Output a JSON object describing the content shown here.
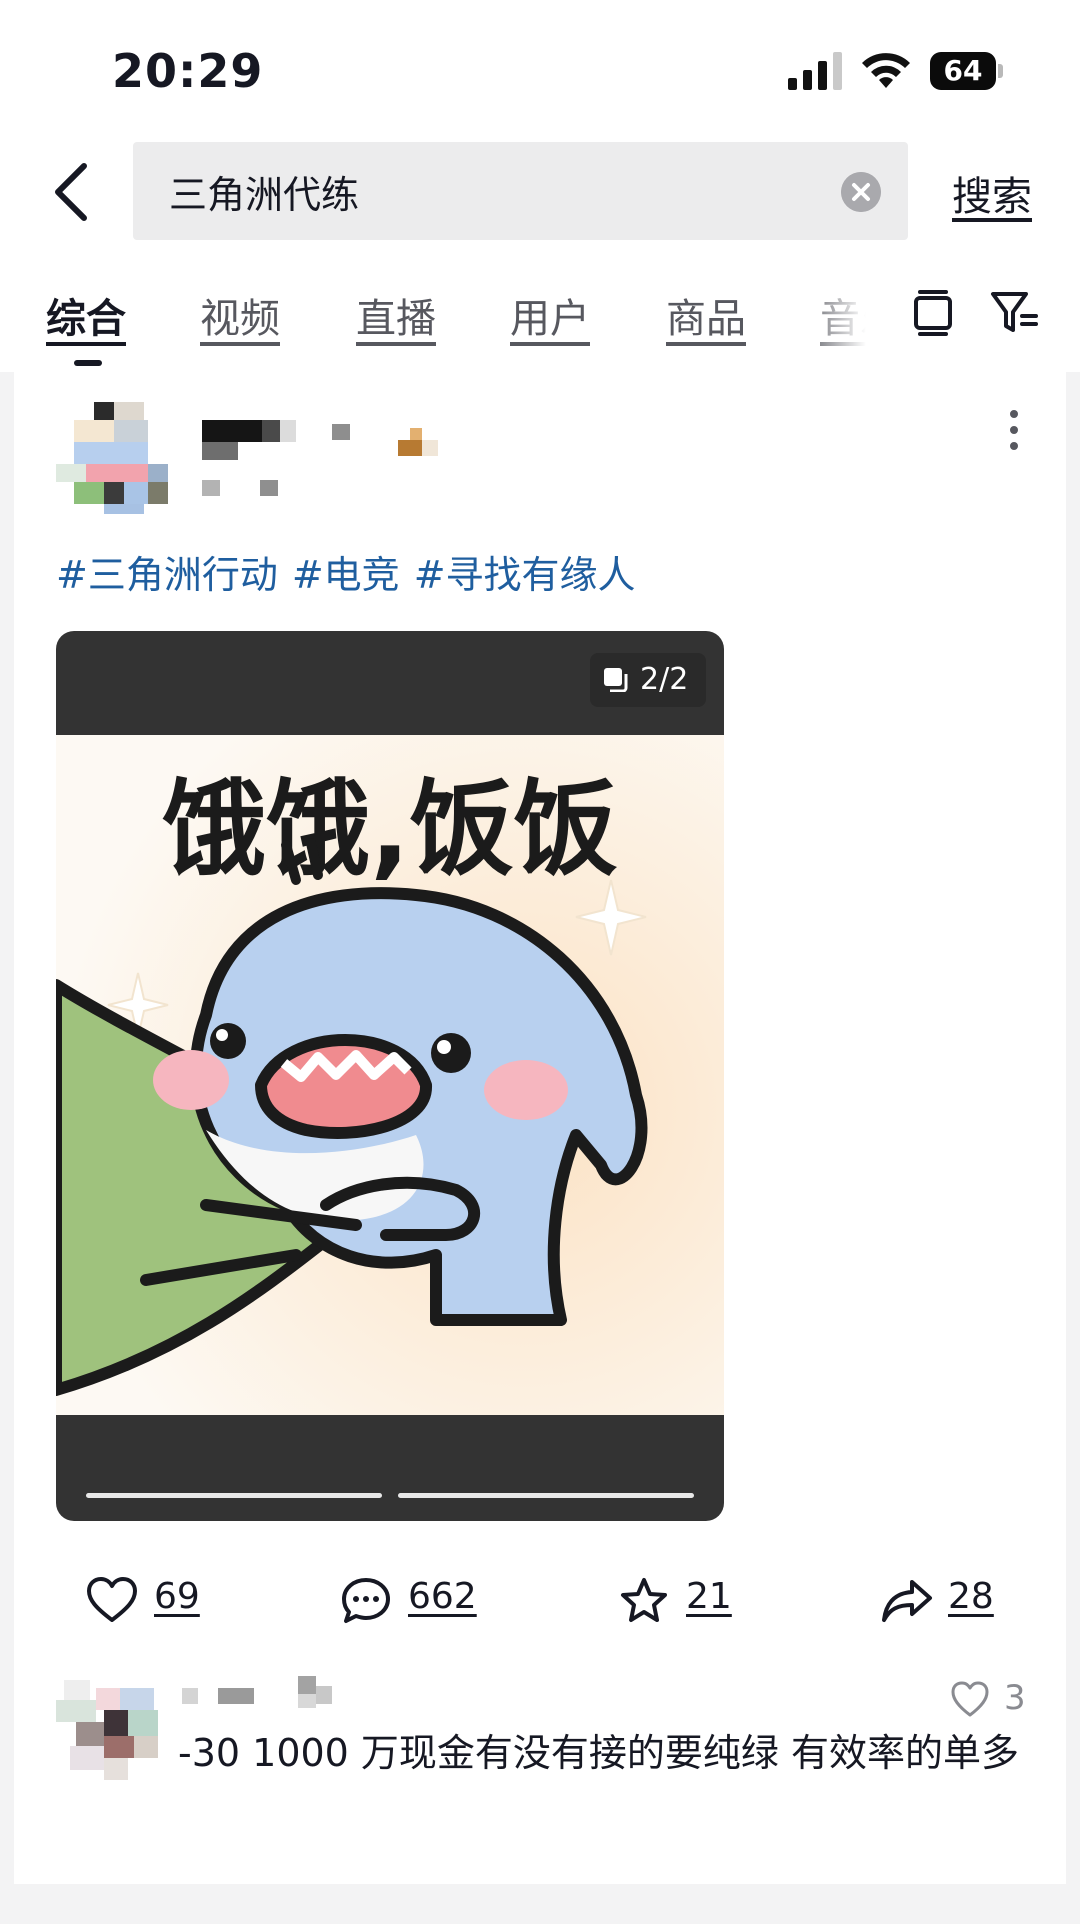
{
  "status_bar": {
    "time": "20:29",
    "battery": "64"
  },
  "search": {
    "query": "三角洲代练",
    "search_label": "搜索"
  },
  "tabs": [
    {
      "label": "综合"
    },
    {
      "label": "视频"
    },
    {
      "label": "直播"
    },
    {
      "label": "用户"
    },
    {
      "label": "商品"
    },
    {
      "label": "音乐"
    }
  ],
  "post": {
    "hashtags": [
      "#三角洲行动",
      "#电竞",
      "#寻找有缘人"
    ],
    "media": {
      "page_indicator": "2/2",
      "sticker_caption": "饿饿,饭饭"
    },
    "actions": {
      "likes": "69",
      "comments": "662",
      "favorites": "21",
      "shares": "28"
    }
  },
  "comment": {
    "text": "-30 1000 万现金有没有接的要纯绿 有效率的单多",
    "likes": "3"
  },
  "colors": {
    "hashtag": "#1f5e9f",
    "search_bg": "#ececed",
    "media_bg": "#333333"
  }
}
